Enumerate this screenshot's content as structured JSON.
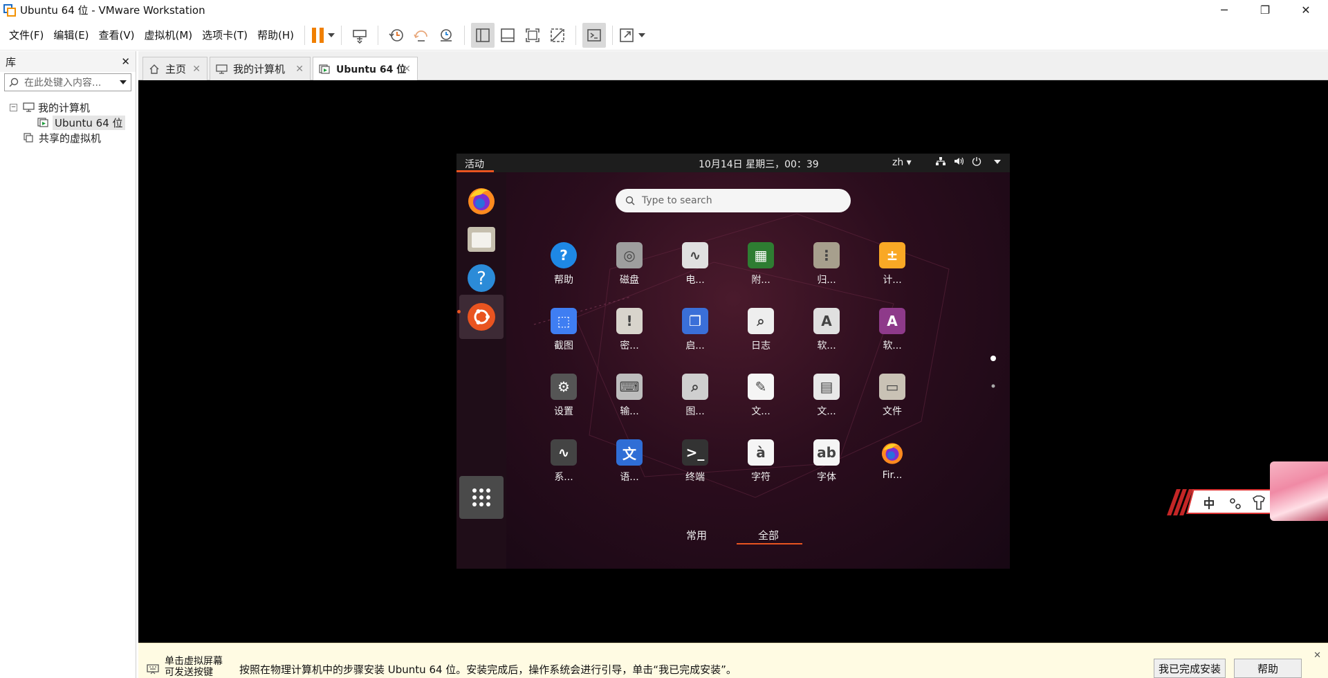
{
  "window": {
    "title": "Ubuntu 64 位 - VMware Workstation",
    "controls": {
      "minimize": "─",
      "restore": "❐",
      "close": "✕"
    }
  },
  "menu": {
    "items": [
      "文件(F)",
      "编辑(E)",
      "查看(V)",
      "虚拟机(M)",
      "选项卡(T)",
      "帮助(H)"
    ]
  },
  "library": {
    "title": "库",
    "close": "✕",
    "search_placeholder": "在此处键入内容...",
    "tree": {
      "root": "我的计算机",
      "vm": "Ubuntu 64 位",
      "shared": "共享的虚拟机"
    }
  },
  "tabs": [
    {
      "label": "主页",
      "icon": "home-icon"
    },
    {
      "label": "我的计算机",
      "icon": "monitor-icon"
    },
    {
      "label": "Ubuntu 64 位",
      "icon": "vm-running-icon"
    }
  ],
  "tab_close": "✕",
  "ubuntu": {
    "activities": "活动",
    "clock": "10月14日 星期三，00：39",
    "lang": "zh ▾",
    "tray": {
      "network": "network-icon",
      "volume": "volume-icon",
      "power": "power-icon"
    },
    "search_placeholder": "Type to search",
    "apps": [
      {
        "label": "帮助",
        "icon": "help-icon",
        "color": "#1e88e5",
        "glyph": "?"
      },
      {
        "label": "磁盘",
        "icon": "disks-icon",
        "color": "#9e9e9e",
        "glyph": "◎"
      },
      {
        "label": "电...",
        "icon": "power-stats-icon",
        "color": "#e0e0e0",
        "glyph": "∿"
      },
      {
        "label": "附...",
        "icon": "additional-drivers-icon",
        "color": "#2e7d32",
        "glyph": "▦"
      },
      {
        "label": "归...",
        "icon": "archive-icon",
        "color": "#a79f8d",
        "glyph": "⋮"
      },
      {
        "label": "计...",
        "icon": "calculator-icon",
        "color": "#f9a825",
        "glyph": "±"
      },
      {
        "label": "截图",
        "icon": "screenshot-icon",
        "color": "#3f7ef2",
        "glyph": "⬚"
      },
      {
        "label": "密...",
        "icon": "passwords-icon",
        "color": "#d8d4cc",
        "glyph": "!"
      },
      {
        "label": "启...",
        "icon": "startup-disk-icon",
        "color": "#3a6fd8",
        "glyph": "❐"
      },
      {
        "label": "日志",
        "icon": "logs-icon",
        "color": "#eeeeee",
        "glyph": "⌕"
      },
      {
        "label": "软...",
        "icon": "software-updater-icon",
        "color": "#e0e0e0",
        "glyph": "A"
      },
      {
        "label": "软...",
        "icon": "software-properties-icon",
        "color": "#8e3a8a",
        "glyph": "A"
      },
      {
        "label": "设置",
        "icon": "settings-icon",
        "color": "#555555",
        "glyph": "⚙"
      },
      {
        "label": "输...",
        "icon": "keyboard-icon",
        "color": "#bdbdbd",
        "glyph": "⌨"
      },
      {
        "label": "图...",
        "icon": "image-viewer-icon",
        "color": "#cfcfcf",
        "glyph": "⌕"
      },
      {
        "label": "文...",
        "icon": "text-editor-icon",
        "color": "#f5f5f5",
        "glyph": "✎"
      },
      {
        "label": "文...",
        "icon": "document-viewer-icon",
        "color": "#e8e8e8",
        "glyph": "▤"
      },
      {
        "label": "文件",
        "icon": "files-icon",
        "color": "#c9c2b5",
        "glyph": "▭"
      },
      {
        "label": "系...",
        "icon": "system-monitor-icon",
        "color": "#444444",
        "glyph": "∿"
      },
      {
        "label": "语...",
        "icon": "language-icon",
        "color": "#2f6ed6",
        "glyph": "文"
      },
      {
        "label": "终端",
        "icon": "terminal-icon",
        "color": "#333333",
        "glyph": ">_"
      },
      {
        "label": "字符",
        "icon": "characters-icon",
        "color": "#f5f5f5",
        "glyph": "à"
      },
      {
        "label": "字体",
        "icon": "fonts-icon",
        "color": "#f5f5f5",
        "glyph": "ab"
      },
      {
        "label": "Fir...",
        "icon": "firefox-icon",
        "color": "#ff7139",
        "glyph": ""
      }
    ],
    "filters": {
      "frequent": "常用",
      "all": "全部"
    }
  },
  "hint": {
    "left_line1": "单击虚拟屏幕",
    "left_line2": "可发送按键",
    "message": "按照在物理计算机中的步骤安装 Ubuntu 64 位。安装完成后，操作系统会进行引导，单击“我已完成安装”。",
    "done_button": "我已完成安装",
    "help_button": "帮助",
    "close": "✕"
  }
}
